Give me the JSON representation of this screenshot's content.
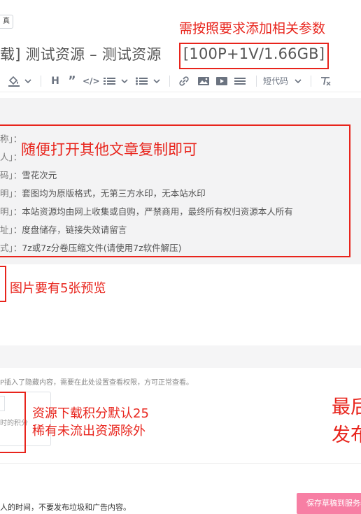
{
  "top": {
    "small_button": "真"
  },
  "annotations": {
    "params_note": "需按照要求添加相关参数",
    "copy_note": "随便打开其他文章复制即可",
    "preview_note": "图片要有5张预览",
    "points_line1": "资源下载积分默认25",
    "points_line2": "稀有未流出资源除外",
    "right_line1": "最后",
    "right_line2": "发布"
  },
  "title": {
    "prefix": "载] 测试资源 – 测试资源",
    "params": "[100P+1V/1.66GB]"
  },
  "toolbar": {
    "shortcode_label": "短代码",
    "icons": [
      "paint-bucket-icon",
      "heading-icon",
      "quote-icon",
      "code-icon",
      "ordered-list-icon",
      "unordered-list-icon",
      "link-icon",
      "image-icon",
      "video-icon",
      "divider-icon",
      "clear-format-icon"
    ]
  },
  "content": {
    "rows": [
      {
        "key": "称」：",
        "value": ""
      },
      {
        "key": "人」：",
        "value": ""
      },
      {
        "key": "码」：",
        "value": "雪花次元"
      },
      {
        "key": "明」：",
        "value": "套图均为原版格式，无第三方水印，无本站水印"
      },
      {
        "key": "明」：",
        "value": "本站资源均由网上收集或自购，严禁商用，最终所有权归资源本人所有"
      },
      {
        "key": "址」：",
        "value": "度盘储存，链接失效请留言"
      },
      {
        "key": "式」：",
        "value": "7z或7z分卷压缩文件(请使用7z软件解压)"
      }
    ]
  },
  "hidden_hint": "P插入了隐藏内容，需要在此处设置查看权限，方可正常查看。",
  "points_field": {
    "label": "时的积分"
  },
  "footer": {
    "note": "人的时间，不要发布垃圾和广告内容。",
    "save_button": "保存草稿到服务器"
  },
  "colors": {
    "annotation_red": "#e8241c",
    "save_button": "#f77fa4"
  }
}
